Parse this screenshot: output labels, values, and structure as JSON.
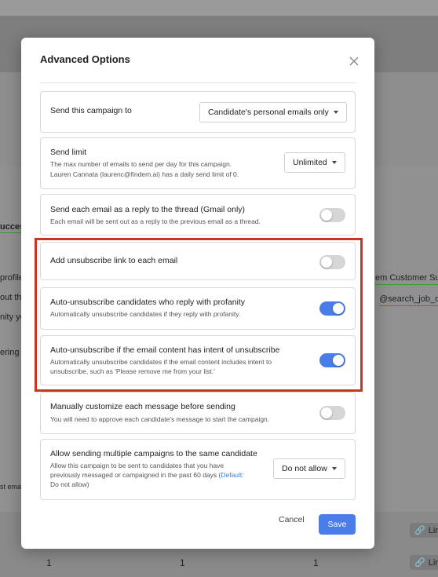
{
  "background": {
    "left_fragments": [
      "ucces",
      "profile",
      "out th",
      "nity yo",
      "ering f",
      "st ema"
    ],
    "right_fragments": [
      "em Customer Suc",
      "@search_job_de"
    ],
    "row_numbers": [
      "1",
      "1",
      "1"
    ],
    "link_label": "Lin"
  },
  "modal": {
    "title": "Advanced Options",
    "options": [
      {
        "title": "Send this campaign to",
        "control": "dropdown",
        "value": "Candidate's personal emails only"
      },
      {
        "title": "Send limit",
        "desc_lines": [
          "The max number of emails to send per day for this campaign.",
          "Lauren Cannata (laurenc@findem.ai) has a daily send limit of 0."
        ],
        "control": "dropdown",
        "value": "Unlimited"
      },
      {
        "title": "Send each email as a reply to the thread (Gmail only)",
        "desc_lines": [
          "Each email will be sent out as a reply to the previous email as a thread."
        ],
        "control": "toggle",
        "on": false
      },
      {
        "title": "Add unsubscribe link to each email",
        "control": "toggle",
        "on": false
      },
      {
        "title": "Auto-unsubscribe candidates who reply with profanity",
        "desc_lines": [
          "Automatically unsubscribe candidates if they reply with profanity."
        ],
        "control": "toggle",
        "on": true
      },
      {
        "title": "Auto-unsubscribe if the email content has intent of unsubscribe",
        "desc_lines": [
          "Automatically unsubscribe candidates if the email content includes intent to",
          "unsubscribe, such as 'Please remove me from your list.'"
        ],
        "control": "toggle",
        "on": true
      },
      {
        "title": "Manually customize each message before sending",
        "desc_lines": [
          "You will need to approve each candidate's message to start the campaign."
        ],
        "control": "toggle",
        "on": false
      },
      {
        "title": "Allow sending multiple campaigns to the same candidate",
        "desc_lines": [
          "Allow this campaign to be sent to candidates that you have",
          "previously messaged or campaigned in the past 60 days ("
        ],
        "desc_link": "Default:",
        "desc_tail": "Do not allow)",
        "control": "dropdown",
        "value": "Do not allow"
      }
    ],
    "cancel_label": "Cancel",
    "save_label": "Save"
  },
  "colors": {
    "accent": "#4a7de8",
    "highlight": "#cc3322",
    "link": "#3b7cd9"
  }
}
